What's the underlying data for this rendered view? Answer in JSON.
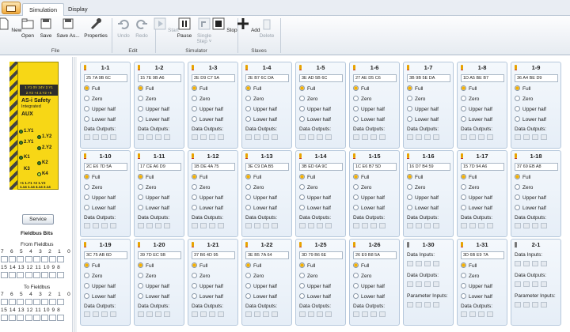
{
  "tabs": {
    "simulation": "Simulation",
    "display": "Display"
  },
  "toolbar": {
    "new": "New",
    "open": "Open",
    "save": "Save",
    "save_as": "Save As...",
    "properties": "Properties",
    "undo": "Undo",
    "redo": "Redo",
    "start": "Start",
    "pause": "Pause",
    "single_step_1": "Single",
    "single_step_2": "Step ˅",
    "stop": "Stop",
    "add": "Add",
    "delete": "Delete"
  },
  "groups": {
    "file": "File",
    "edit": "Edit",
    "simulator": "Simulator",
    "slaves": "Slaves"
  },
  "module": {
    "status_row1": "1.Y1 0V 24V 2.Y1",
    "status_row2": "2.Y2 +4 2.Y2 +5",
    "title": "AS-i Safety",
    "subtitle": "Integrated",
    "aux": "AUX",
    "l1": "1.Y1",
    "l2": "1.Y2",
    "l3": "2.Y1",
    "l4": "2.Y2",
    "l5": "K1",
    "l6": "K2",
    "l7": "K3",
    "l8": "K4",
    "bottom_row1": "+1 1.Y1 +2 1.Y2",
    "bottom_row2": "1.14 1.14 4.14 2.14"
  },
  "left": {
    "service": "Service",
    "fieldbus_bits": "Fieldbus Bits",
    "from_fieldbus": "From Fieldbus",
    "to_fieldbus": "To Fieldbus",
    "bits_hi": "7 6 5 4 3 2 1 0",
    "bits_lo": "15 14 13 12 11 10 9 8"
  },
  "labels": {
    "full": "Full",
    "zero": "Zero",
    "upper_half": "Upper half",
    "lower_half": "Lower half",
    "data_outputs": "Data Outputs:",
    "data_inputs": "Data Inputs:",
    "parameter_inputs": "Parameter Inputs:"
  },
  "slaves": [
    {
      "id": "1-1",
      "addr": "25 7A 9B 6C"
    },
    {
      "id": "1-2",
      "addr": "15 7E 9B A6"
    },
    {
      "id": "1-3",
      "addr": "2E D9 C7 5A"
    },
    {
      "id": "1-4",
      "addr": "2E B7 6C DA"
    },
    {
      "id": "1-5",
      "addr": "3E AD 5B 6C"
    },
    {
      "id": "1-6",
      "addr": "27 AE D5 C6"
    },
    {
      "id": "1-7",
      "addr": "3B 9B 5E DA"
    },
    {
      "id": "1-8",
      "addr": "1D A5 BE B7"
    },
    {
      "id": "1-9",
      "addr": "36 A4 BE D9"
    },
    {
      "id": "1-10",
      "addr": "2C E6 7D 5A"
    },
    {
      "id": "1-11",
      "addr": "17 CE A6 D9"
    },
    {
      "id": "1-12",
      "addr": "1B DE 4A 75"
    },
    {
      "id": "1-13",
      "addr": "3E C9 DA B5"
    },
    {
      "id": "1-14",
      "addr": "3B ED 6A 9C"
    },
    {
      "id": "1-15",
      "addr": "1C E6 B7 5D"
    },
    {
      "id": "1-16",
      "addr": "16 D7 B4 59"
    },
    {
      "id": "1-17",
      "addr": "15 7D 94 A6"
    },
    {
      "id": "1-18",
      "addr": "37 69 EB A8"
    },
    {
      "id": "1-19",
      "addr": "3C 75 AB 6D"
    },
    {
      "id": "1-20",
      "addr": "39 7D EC 5B"
    },
    {
      "id": "1-21",
      "addr": "37 B6 4D 95"
    },
    {
      "id": "1-22",
      "addr": "3E B5 7A 64"
    },
    {
      "id": "1-25",
      "addr": "3D 79 B6 6E"
    },
    {
      "id": "1-26",
      "addr": "26 E9 B8 5A"
    },
    {
      "id": "1-30"
    },
    {
      "id": "1-31",
      "addr": "3D 6B E9 7A"
    },
    {
      "id": "2-1"
    }
  ]
}
